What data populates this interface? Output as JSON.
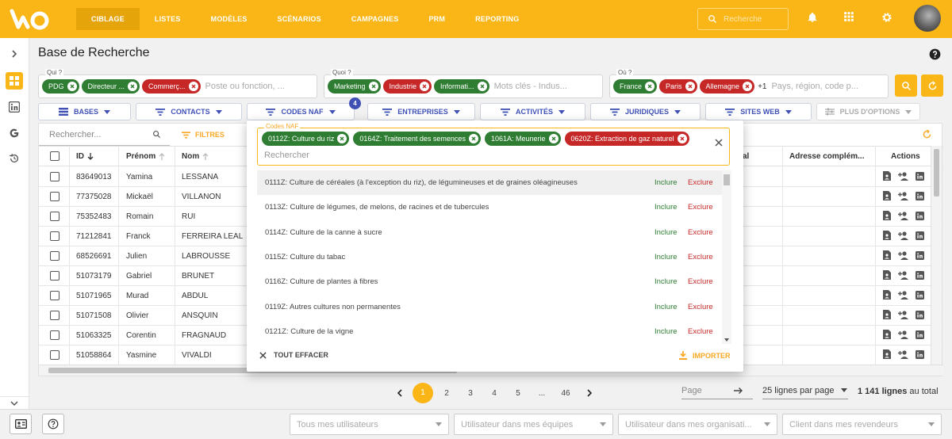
{
  "nav": {
    "items": [
      {
        "label": "CIBLAGE",
        "active": true
      },
      {
        "label": "LISTES"
      },
      {
        "label": "MODÈLES"
      },
      {
        "label": "SCÉNARIOS"
      },
      {
        "label": "CAMPAGNES"
      },
      {
        "label": "PRM"
      },
      {
        "label": "REPORTING"
      }
    ]
  },
  "topbar": {
    "search_placeholder": "Recherche"
  },
  "page": {
    "title": "Base de Recherche"
  },
  "filters": {
    "qui1": {
      "label": "Qui ?",
      "chips": [
        {
          "text": "PDG",
          "color": "green"
        },
        {
          "text": "Directeur ...",
          "color": "green"
        },
        {
          "text": "Commerç...",
          "color": "red"
        }
      ],
      "placeholder": "Poste ou fonction, ..."
    },
    "qui2": {
      "label": "Quoi ?",
      "chips": [
        {
          "text": "Marketing",
          "color": "green"
        },
        {
          "text": "Industrie",
          "color": "red"
        },
        {
          "text": "Informati...",
          "color": "green"
        }
      ],
      "placeholder": "Mots clés - Indus..."
    },
    "ou": {
      "label": "Où ?",
      "chips": [
        {
          "text": "France",
          "color": "green"
        },
        {
          "text": "Paris",
          "color": "red"
        },
        {
          "text": "Allemagne",
          "color": "red"
        }
      ],
      "more": "+1",
      "placeholder": "Pays, région, code p..."
    }
  },
  "categories": [
    {
      "label": "BASES"
    },
    {
      "label": "CONTACTS"
    },
    {
      "label": "CODES NAF",
      "badge": "4"
    },
    {
      "label": "ENTREPRISES"
    },
    {
      "label": "ACTIVITÉS"
    },
    {
      "label": "JURIDIQUES"
    },
    {
      "label": "SITES WEB"
    },
    {
      "label": "PLUS D'OPTIONS",
      "disabled": true
    }
  ],
  "grid": {
    "search_placeholder": "Rechercher...",
    "filters_label": "FILTRES",
    "columns": {
      "id": "ID",
      "prenom": "Prénom",
      "nom": "Nom",
      "col_al": "al",
      "adresse": "Adresse complém...",
      "actions": "Actions"
    },
    "rows": [
      {
        "id": "83649013",
        "prenom": "Yamina",
        "nom": "LESSANA"
      },
      {
        "id": "77375028",
        "prenom": "Mickaël",
        "nom": "VILLANON"
      },
      {
        "id": "75352483",
        "prenom": "Romain",
        "nom": "RUI"
      },
      {
        "id": "71212841",
        "prenom": "Franck",
        "nom": "FERREIRA LEAL"
      },
      {
        "id": "68526691",
        "prenom": "Julien",
        "nom": "LABROUSSE"
      },
      {
        "id": "51073179",
        "prenom": "Gabriel",
        "nom": "BRUNET"
      },
      {
        "id": "51071965",
        "prenom": "Murad",
        "nom": "ABDUL"
      },
      {
        "id": "51071508",
        "prenom": "Olivier",
        "nom": "ANSQUIN"
      },
      {
        "id": "51063325",
        "prenom": "Corentin",
        "nom": "FRAGNAUD"
      },
      {
        "id": "51058864",
        "prenom": "Yasmine",
        "nom": "VIVALDI"
      }
    ]
  },
  "naf_panel": {
    "label": "Codes NAF",
    "chips": [
      {
        "text": "0112Z: Culture du riz",
        "color": "green"
      },
      {
        "text": "0164Z: Traitement des semences",
        "color": "green"
      },
      {
        "text": "1061A: Meunerie",
        "color": "green"
      },
      {
        "text": "0620Z: Extraction de gaz naturel",
        "color": "red"
      }
    ],
    "search_placeholder": "Rechercher",
    "options": [
      "0111Z: Culture de céréales (à l'exception du riz), de légumineuses et de graines oléagineuses",
      "0113Z: Culture de légumes, de melons, de racines et de tubercules",
      "0114Z: Culture de la canne à sucre",
      "0115Z: Culture du tabac",
      "0116Z: Culture de plantes à fibres",
      "0119Z: Autres cultures non permanentes",
      "0121Z: Culture de la vigne"
    ],
    "include_label": "Inclure",
    "exclude_label": "Exclure",
    "clear_all": "TOUT EFFACER",
    "import": "IMPORTER"
  },
  "pagination": {
    "pages": [
      "1",
      "2",
      "3",
      "4",
      "5",
      "...",
      "46"
    ],
    "current": "1",
    "page_placeholder": "Page",
    "per_page": "25 lignes par page",
    "total_bold": "1 141 lignes",
    "total_rest": " au total"
  },
  "bottom": {
    "selects": [
      "Tous mes utilisateurs",
      "Utilisateur dans mes équipes",
      "Utilisateur dans mes organisati...",
      "Client dans mes revendeurs"
    ]
  },
  "colors": {
    "accent": "#f9b616",
    "include": "#2e7d32",
    "exclude": "#c62828",
    "primary": "#3f51b5"
  }
}
